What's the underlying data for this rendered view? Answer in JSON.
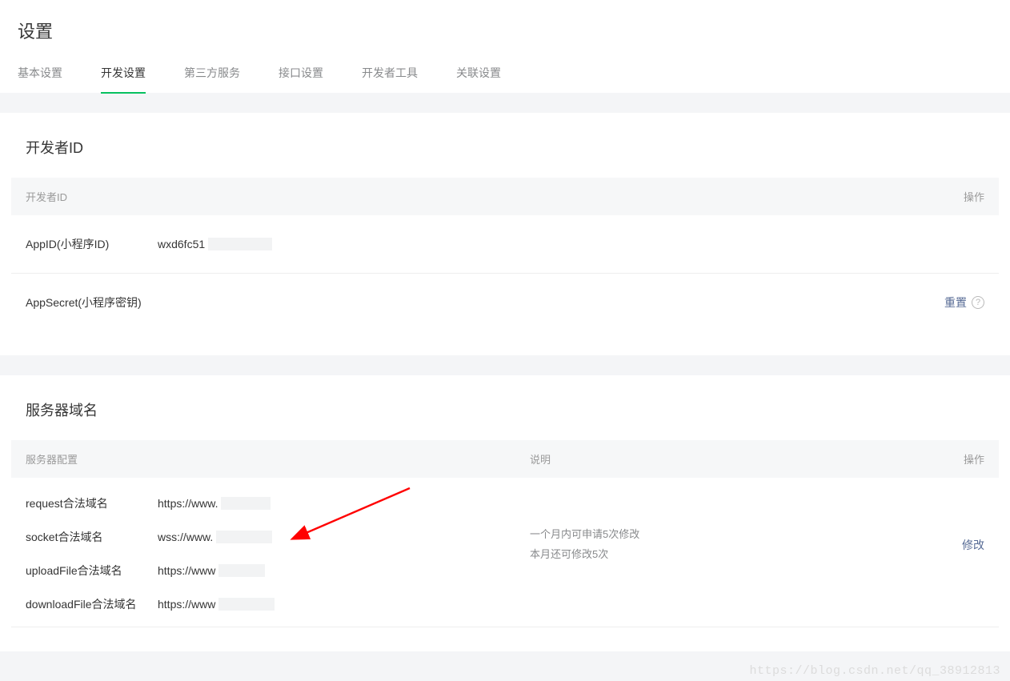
{
  "page": {
    "title": "设置"
  },
  "tabs": [
    {
      "label": "基本设置",
      "active": false
    },
    {
      "label": "开发设置",
      "active": true
    },
    {
      "label": "第三方服务",
      "active": false
    },
    {
      "label": "接口设置",
      "active": false
    },
    {
      "label": "开发者工具",
      "active": false
    },
    {
      "label": "关联设置",
      "active": false
    }
  ],
  "developer_id": {
    "section_title": "开发者ID",
    "header_left": "开发者ID",
    "header_right": "操作",
    "appid_label": "AppID(小程序ID)",
    "appid_value": "wxd6fc51",
    "appsecret_label": "AppSecret(小程序密钥)",
    "reset_label": "重置"
  },
  "server_domain": {
    "section_title": "服务器域名",
    "header_col1": "服务器配置",
    "header_col2": "说明",
    "header_col3": "操作",
    "rows": [
      {
        "label": "request合法域名",
        "value": "https://www."
      },
      {
        "label": "socket合法域名",
        "value": "wss://www."
      },
      {
        "label": "uploadFile合法域名",
        "value": "https://www"
      },
      {
        "label": "downloadFile合法域名",
        "value": "https://www"
      }
    ],
    "desc_line1": "一个月内可申请5次修改",
    "desc_line2": "本月还可修改5次",
    "modify_label": "修改"
  },
  "watermark": "https://blog.csdn.net/qq_38912813"
}
